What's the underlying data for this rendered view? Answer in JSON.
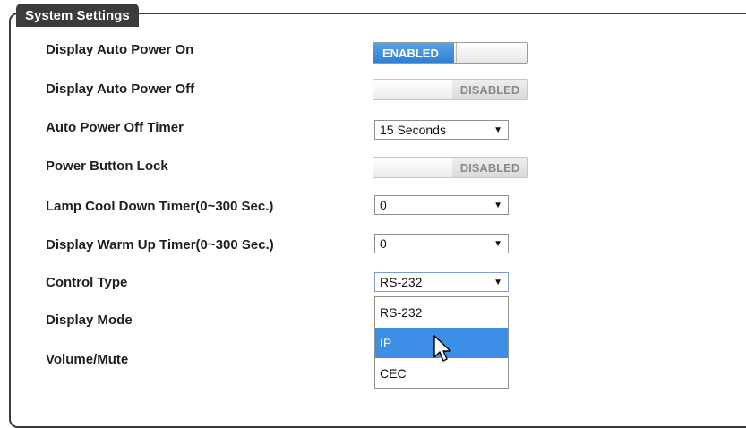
{
  "panel": {
    "title": "System Settings"
  },
  "rows": [
    {
      "label": "Display Auto Power On"
    },
    {
      "label": "Display Auto Power Off"
    },
    {
      "label": "Auto Power Off Timer"
    },
    {
      "label": "Power Button Lock"
    },
    {
      "label": "Lamp Cool Down Timer(0~300 Sec.)"
    },
    {
      "label": "Display Warm Up Timer(0~300 Sec.)"
    },
    {
      "label": "Control Type"
    },
    {
      "label": "Display Mode"
    },
    {
      "label": "Volume/Mute"
    }
  ],
  "controls": {
    "auto_power_on": {
      "state": "ENABLED"
    },
    "auto_power_off": {
      "state": "DISABLED"
    },
    "auto_power_off_timer": {
      "value": "15 Seconds"
    },
    "power_button_lock": {
      "state": "DISABLED"
    },
    "lamp_cool_down": {
      "value": "0"
    },
    "warm_up": {
      "value": "0"
    },
    "control_type": {
      "value": "RS-232",
      "options": [
        "RS-232",
        "IP",
        "CEC"
      ],
      "highlighted": "IP"
    }
  },
  "colors": {
    "accent": "#3d8ee6",
    "panel_border": "#3a3a3a",
    "title_bg": "#3b3b3b"
  },
  "icons": {
    "arrow": "▼",
    "cursor": "mouse-pointer-icon"
  }
}
